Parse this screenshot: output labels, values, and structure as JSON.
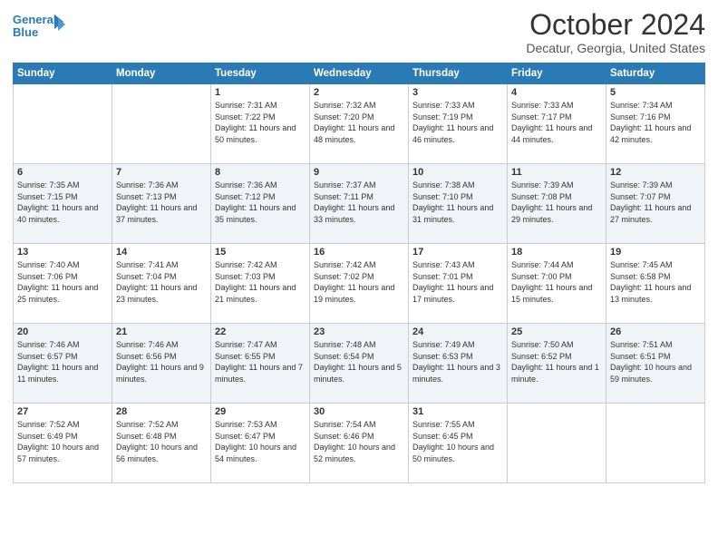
{
  "header": {
    "logo_line1": "General",
    "logo_line2": "Blue",
    "month": "October 2024",
    "location": "Decatur, Georgia, United States"
  },
  "weekdays": [
    "Sunday",
    "Monday",
    "Tuesday",
    "Wednesday",
    "Thursday",
    "Friday",
    "Saturday"
  ],
  "weeks": [
    [
      {
        "day": "",
        "text": ""
      },
      {
        "day": "",
        "text": ""
      },
      {
        "day": "1",
        "text": "Sunrise: 7:31 AM\nSunset: 7:22 PM\nDaylight: 11 hours and 50 minutes."
      },
      {
        "day": "2",
        "text": "Sunrise: 7:32 AM\nSunset: 7:20 PM\nDaylight: 11 hours and 48 minutes."
      },
      {
        "day": "3",
        "text": "Sunrise: 7:33 AM\nSunset: 7:19 PM\nDaylight: 11 hours and 46 minutes."
      },
      {
        "day": "4",
        "text": "Sunrise: 7:33 AM\nSunset: 7:17 PM\nDaylight: 11 hours and 44 minutes."
      },
      {
        "day": "5",
        "text": "Sunrise: 7:34 AM\nSunset: 7:16 PM\nDaylight: 11 hours and 42 minutes."
      }
    ],
    [
      {
        "day": "6",
        "text": "Sunrise: 7:35 AM\nSunset: 7:15 PM\nDaylight: 11 hours and 40 minutes."
      },
      {
        "day": "7",
        "text": "Sunrise: 7:36 AM\nSunset: 7:13 PM\nDaylight: 11 hours and 37 minutes."
      },
      {
        "day": "8",
        "text": "Sunrise: 7:36 AM\nSunset: 7:12 PM\nDaylight: 11 hours and 35 minutes."
      },
      {
        "day": "9",
        "text": "Sunrise: 7:37 AM\nSunset: 7:11 PM\nDaylight: 11 hours and 33 minutes."
      },
      {
        "day": "10",
        "text": "Sunrise: 7:38 AM\nSunset: 7:10 PM\nDaylight: 11 hours and 31 minutes."
      },
      {
        "day": "11",
        "text": "Sunrise: 7:39 AM\nSunset: 7:08 PM\nDaylight: 11 hours and 29 minutes."
      },
      {
        "day": "12",
        "text": "Sunrise: 7:39 AM\nSunset: 7:07 PM\nDaylight: 11 hours and 27 minutes."
      }
    ],
    [
      {
        "day": "13",
        "text": "Sunrise: 7:40 AM\nSunset: 7:06 PM\nDaylight: 11 hours and 25 minutes."
      },
      {
        "day": "14",
        "text": "Sunrise: 7:41 AM\nSunset: 7:04 PM\nDaylight: 11 hours and 23 minutes."
      },
      {
        "day": "15",
        "text": "Sunrise: 7:42 AM\nSunset: 7:03 PM\nDaylight: 11 hours and 21 minutes."
      },
      {
        "day": "16",
        "text": "Sunrise: 7:42 AM\nSunset: 7:02 PM\nDaylight: 11 hours and 19 minutes."
      },
      {
        "day": "17",
        "text": "Sunrise: 7:43 AM\nSunset: 7:01 PM\nDaylight: 11 hours and 17 minutes."
      },
      {
        "day": "18",
        "text": "Sunrise: 7:44 AM\nSunset: 7:00 PM\nDaylight: 11 hours and 15 minutes."
      },
      {
        "day": "19",
        "text": "Sunrise: 7:45 AM\nSunset: 6:58 PM\nDaylight: 11 hours and 13 minutes."
      }
    ],
    [
      {
        "day": "20",
        "text": "Sunrise: 7:46 AM\nSunset: 6:57 PM\nDaylight: 11 hours and 11 minutes."
      },
      {
        "day": "21",
        "text": "Sunrise: 7:46 AM\nSunset: 6:56 PM\nDaylight: 11 hours and 9 minutes."
      },
      {
        "day": "22",
        "text": "Sunrise: 7:47 AM\nSunset: 6:55 PM\nDaylight: 11 hours and 7 minutes."
      },
      {
        "day": "23",
        "text": "Sunrise: 7:48 AM\nSunset: 6:54 PM\nDaylight: 11 hours and 5 minutes."
      },
      {
        "day": "24",
        "text": "Sunrise: 7:49 AM\nSunset: 6:53 PM\nDaylight: 11 hours and 3 minutes."
      },
      {
        "day": "25",
        "text": "Sunrise: 7:50 AM\nSunset: 6:52 PM\nDaylight: 11 hours and 1 minute."
      },
      {
        "day": "26",
        "text": "Sunrise: 7:51 AM\nSunset: 6:51 PM\nDaylight: 10 hours and 59 minutes."
      }
    ],
    [
      {
        "day": "27",
        "text": "Sunrise: 7:52 AM\nSunset: 6:49 PM\nDaylight: 10 hours and 57 minutes."
      },
      {
        "day": "28",
        "text": "Sunrise: 7:52 AM\nSunset: 6:48 PM\nDaylight: 10 hours and 56 minutes."
      },
      {
        "day": "29",
        "text": "Sunrise: 7:53 AM\nSunset: 6:47 PM\nDaylight: 10 hours and 54 minutes."
      },
      {
        "day": "30",
        "text": "Sunrise: 7:54 AM\nSunset: 6:46 PM\nDaylight: 10 hours and 52 minutes."
      },
      {
        "day": "31",
        "text": "Sunrise: 7:55 AM\nSunset: 6:45 PM\nDaylight: 10 hours and 50 minutes."
      },
      {
        "day": "",
        "text": ""
      },
      {
        "day": "",
        "text": ""
      }
    ]
  ]
}
